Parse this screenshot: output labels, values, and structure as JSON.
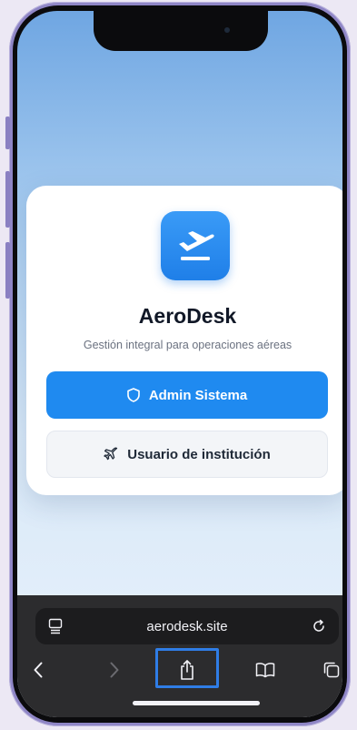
{
  "app": {
    "title": "AeroDesk",
    "subtitle": "Gestión integral para operaciones aéreas",
    "icon": "plane-departure-icon"
  },
  "buttons": {
    "admin": {
      "label": "Admin Sistema",
      "icon": "shield-icon"
    },
    "institution": {
      "label": "Usuario de institución",
      "icon": "plane-icon"
    }
  },
  "browser": {
    "url": "aerodesk.site",
    "tabs_icon": "tab-overview-icon",
    "reload_icon": "reload-icon",
    "toolbar": [
      "back-icon",
      "forward-icon",
      "share-icon",
      "bookmarks-icon",
      "tabs-icon"
    ]
  },
  "colors": {
    "accent": "#1f8af0",
    "highlight": "#2f7de6",
    "frame": "#8f86c6"
  }
}
